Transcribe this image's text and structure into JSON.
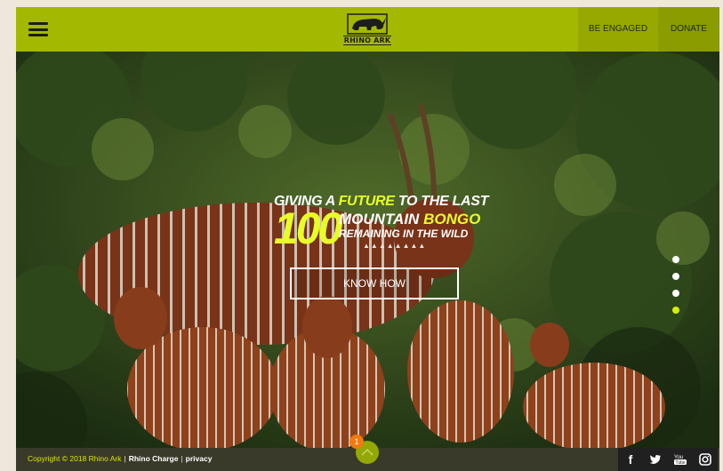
{
  "header": {
    "logo_text": "RHINO ARK",
    "nav": {
      "be_engaged": "BE ENGAGED",
      "donate": "DONATE"
    }
  },
  "hero": {
    "headline": {
      "line1_pre": "GIVING A ",
      "line1_highlight": "FUTURE",
      "line1_post": " TO THE LAST",
      "number": "100",
      "line2_pre": "MOUNTAIN ",
      "line2_highlight": "BONGO",
      "line3": "REMAINING IN THE WILD"
    },
    "cta_label": "KNOW HOW",
    "slides": {
      "count": 4,
      "active_index": 3
    }
  },
  "footer": {
    "copyright": "Copyright © 2018 Rhino Ark",
    "separator": "|",
    "link_rhino_charge": "Rhino Charge",
    "link_privacy": "privacy",
    "notification_count": "1",
    "social": {
      "facebook": "f",
      "twitter": "twitter-icon",
      "youtube": "youtube-icon",
      "instagram": "instagram-icon"
    }
  },
  "colors": {
    "header_bg": "#a3b800",
    "accent_yellow": "#e8ff27",
    "footer_bg": "#3a3a2a",
    "notification": "#f07a10"
  }
}
